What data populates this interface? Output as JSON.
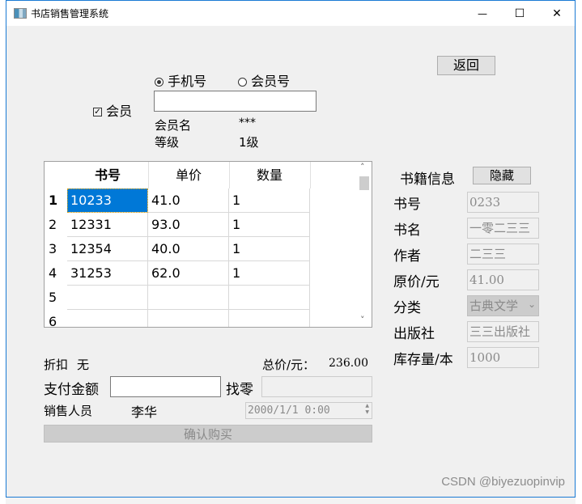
{
  "window": {
    "title": "书店销售管理系统",
    "controls": {
      "minimize": "—",
      "maximize": "☐",
      "close": "✕"
    }
  },
  "back_button": "返回",
  "member": {
    "checkbox_label": "会员",
    "checked": true,
    "radio_options": [
      {
        "label": "手机号",
        "selected": true
      },
      {
        "label": "会员号",
        "selected": false
      }
    ],
    "input_value": "",
    "name_label": "会员名",
    "name_value": "***",
    "level_label": "等级",
    "level_value": "1级"
  },
  "cart_table": {
    "columns": [
      "书号",
      "单价",
      "数量"
    ],
    "rows": [
      {
        "index": "1",
        "book_no": "10233",
        "price": "41.0",
        "qty": "1",
        "selected": true
      },
      {
        "index": "2",
        "book_no": "12331",
        "price": "93.0",
        "qty": "1"
      },
      {
        "index": "3",
        "book_no": "12354",
        "price": "40.0",
        "qty": "1"
      },
      {
        "index": "4",
        "book_no": "31253",
        "price": "62.0",
        "qty": "1"
      },
      {
        "index": "5",
        "book_no": "",
        "price": "",
        "qty": ""
      },
      {
        "index": "6",
        "book_no": "",
        "price": "",
        "qty": ""
      }
    ]
  },
  "book_info": {
    "title": "书籍信息",
    "hide_button": "隐藏",
    "fields": [
      {
        "label": "书号",
        "value": "0233"
      },
      {
        "label": "书名",
        "value": "一零二三三"
      },
      {
        "label": "作者",
        "value": "二三三"
      },
      {
        "label": "原价/元",
        "value": "41.00"
      },
      {
        "label": "分类",
        "value": "古典文学"
      },
      {
        "label": "出版社",
        "value": "三三出版社"
      },
      {
        "label": "库存量/本",
        "value": "1000"
      }
    ]
  },
  "summary": {
    "discount_label": "折扣",
    "discount_value": "无",
    "total_label": "总价/元：",
    "total_value": "236.00",
    "pay_label": "支付金额",
    "pay_value": "",
    "change_label": "找零",
    "change_value": "",
    "seller_label": "销售人员",
    "seller_value": "李华",
    "datetime": "2000/1/1 0:00",
    "confirm_button": "确认购买"
  },
  "watermark": "CSDN @biyezuopinvip",
  "icons": {
    "spin_up": "▲",
    "spin_down": "▼",
    "combo_arrow": "⌄",
    "scroll_up": "˄",
    "scroll_down": "˅",
    "check": "✓"
  }
}
